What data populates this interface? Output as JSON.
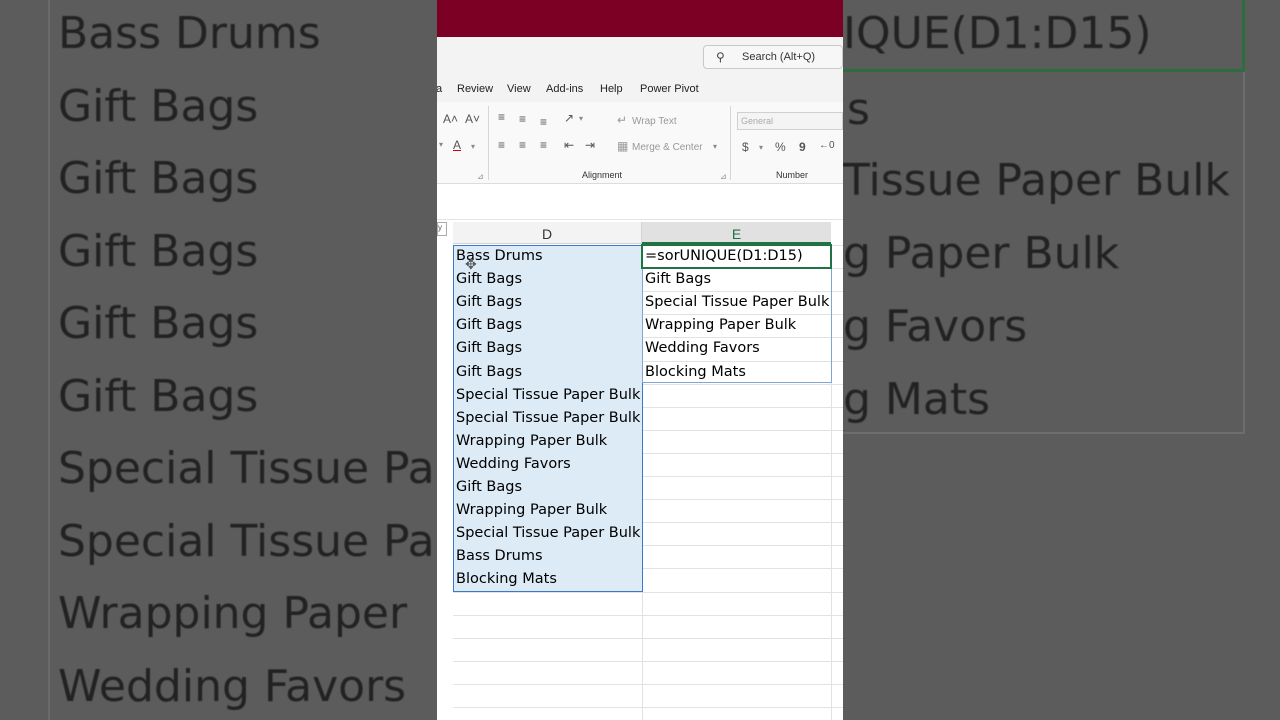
{
  "search": {
    "placeholder": "Search (Alt+Q)"
  },
  "menu": [
    "a",
    "Review",
    "View",
    "Add-ins",
    "Help",
    "Power Pivot"
  ],
  "ribbon": {
    "wrap_text": "Wrap Text",
    "merge_center": "Merge & Center",
    "number_format": "General",
    "alignment_label": "Alignment",
    "number_label": "Number",
    "currency": "$",
    "percent": "%",
    "comma": "9"
  },
  "columns": {
    "d": "D",
    "e": "E"
  },
  "column_d": [
    "Bass Drums",
    "Gift Bags",
    "Gift Bags",
    "Gift Bags",
    "Gift Bags",
    "Gift Bags",
    "Special Tissue Paper Bulk",
    "Special Tissue Paper Bulk",
    "Wrapping Paper Bulk",
    "Wedding Favors",
    "Gift Bags",
    "Wrapping Paper Bulk",
    "Special Tissue Paper Bulk",
    "Bass Drums",
    "Blocking Mats"
  ],
  "column_e": [
    "=sorUNIQUE(D1:D15)",
    "Gift Bags",
    "Special Tissue Paper Bulk",
    "Wrapping Paper Bulk",
    "Wedding Favors",
    "Blocking Mats"
  ],
  "zoom_left": [
    "Bass Drums",
    "Gift Bags",
    "Gift Bags",
    "Gift Bags",
    "Gift Bags",
    "Gift Bags",
    "Special Tissue Pa",
    "Special Tissue Pa",
    "Wrapping Paper",
    "Wedding Favors"
  ],
  "zoom_right": [
    "IQUE(D1:D15)",
    "s",
    "Tissue Paper Bulk",
    "g Paper Bulk",
    "g Favors",
    "g Mats"
  ]
}
